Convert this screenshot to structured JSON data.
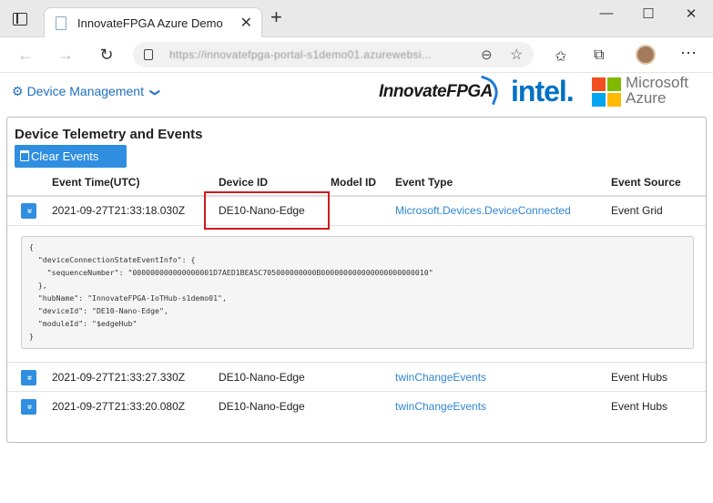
{
  "browser": {
    "tab_title": "InnovateFPGA Azure Demo",
    "tab_close": "✕",
    "new_tab": "+",
    "window_min": "—",
    "window_max": "☐",
    "window_close": "✕",
    "url": "https://innovatefpga-portal-s1demo01.azurewebsi...",
    "nav_back": "←",
    "nav_forward": "→",
    "nav_refresh": "↻",
    "zoom_icon": "⊖",
    "star_icon": "☆",
    "favorites_icon": "✩",
    "collections_icon": "⧉",
    "more_icon": "⋯"
  },
  "header": {
    "device_management": "Device Management",
    "chevron": "❯",
    "gear": "⚙",
    "logo_innovate": "InnovateFPGA",
    "logo_intel": "intel.",
    "logo_ms_line1": "Microsoft",
    "logo_ms_line2": "Azure"
  },
  "panel": {
    "title": "Device Telemetry and Events",
    "clear_button": "Clear Events",
    "columns": [
      "Event Time(UTC)",
      "Device ID",
      "Model ID",
      "Event Type",
      "Event Source"
    ],
    "rows": [
      {
        "time": "2021-09-27T21:33:18.030Z",
        "device_id": "DE10-Nano-Edge",
        "model_id": "",
        "event_type": "Microsoft.Devices.DeviceConnected",
        "event_source": "Event Grid"
      },
      {
        "time": "2021-09-27T21:33:27.330Z",
        "device_id": "DE10-Nano-Edge",
        "model_id": "",
        "event_type": "twinChangeEvents",
        "event_source": "Event Hubs"
      },
      {
        "time": "2021-09-27T21:33:20.080Z",
        "device_id": "DE10-Nano-Edge",
        "model_id": "",
        "event_type": "twinChangeEvents",
        "event_source": "Event Hubs"
      }
    ],
    "expand_icon": "»",
    "json_detail": "{\n  \"deviceConnectionStateEventInfo\": {\n    \"sequenceNumber\": \"000000000000000001D7AED1BEA5C705000000000B000000000000000000000010\"\n  },\n  \"hubName\": \"InnovateFPGA-IoTHub-s1demo01\",\n  \"deviceId\": \"DE10-Nano-Edge\",\n  \"moduleId\": \"$edgeHub\"\n}"
  },
  "colors": {
    "accent": "#2f8ee0",
    "link": "#2f86d0",
    "highlight": "#d01a1a",
    "ms_red": "#f25022",
    "ms_green": "#7fba00",
    "ms_blue": "#00a4ef",
    "ms_yellow": "#ffb900"
  }
}
